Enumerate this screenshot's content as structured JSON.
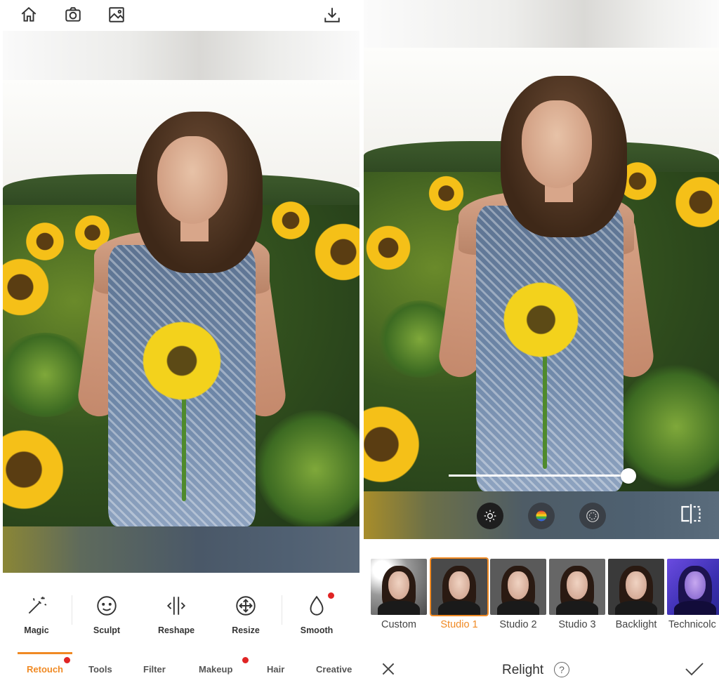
{
  "left": {
    "top_bar": {
      "icons": [
        "home-icon",
        "camera-icon",
        "gallery-icon",
        "download-icon"
      ]
    },
    "tools": [
      {
        "label": "Magic",
        "icon": "magic-wand-icon",
        "badge": false
      },
      {
        "label": "Sculpt",
        "icon": "smiley-face-icon",
        "badge": false
      },
      {
        "label": "Reshape",
        "icon": "reshape-arrows-icon",
        "badge": false
      },
      {
        "label": "Resize",
        "icon": "resize-arrows-icon",
        "badge": false
      },
      {
        "label": "Smooth",
        "icon": "droplet-icon",
        "badge": true
      }
    ],
    "tabs": [
      {
        "label": "Retouch",
        "active": true,
        "badge": true
      },
      {
        "label": "Tools",
        "active": false,
        "badge": false
      },
      {
        "label": "Filter",
        "active": false,
        "badge": false
      },
      {
        "label": "Makeup",
        "active": false,
        "badge": true
      },
      {
        "label": "Hair",
        "active": false,
        "badge": false
      },
      {
        "label": "Creative",
        "active": false,
        "badge": false
      }
    ]
  },
  "right": {
    "slider_value": 0.95,
    "adjust_icons": [
      "brightness-icon",
      "color-icon",
      "vignette-icon",
      "compare-icon"
    ],
    "presets": [
      {
        "label": "Custom",
        "active": false,
        "style": "custom"
      },
      {
        "label": "Studio 1",
        "active": true,
        "style": "studio1"
      },
      {
        "label": "Studio 2",
        "active": false,
        "style": "studio2"
      },
      {
        "label": "Studio 3",
        "active": false,
        "style": "studio3"
      },
      {
        "label": "Backlight",
        "active": false,
        "style": "backlight"
      },
      {
        "label": "Technicolc",
        "active": false,
        "style": "technicolor"
      }
    ],
    "bottom_bar": {
      "title": "Relight",
      "help": "?",
      "icons": [
        "close-icon",
        "help-icon",
        "checkmark-icon"
      ]
    }
  },
  "colors": {
    "accent": "#f08a24",
    "badge": "#e02424"
  }
}
